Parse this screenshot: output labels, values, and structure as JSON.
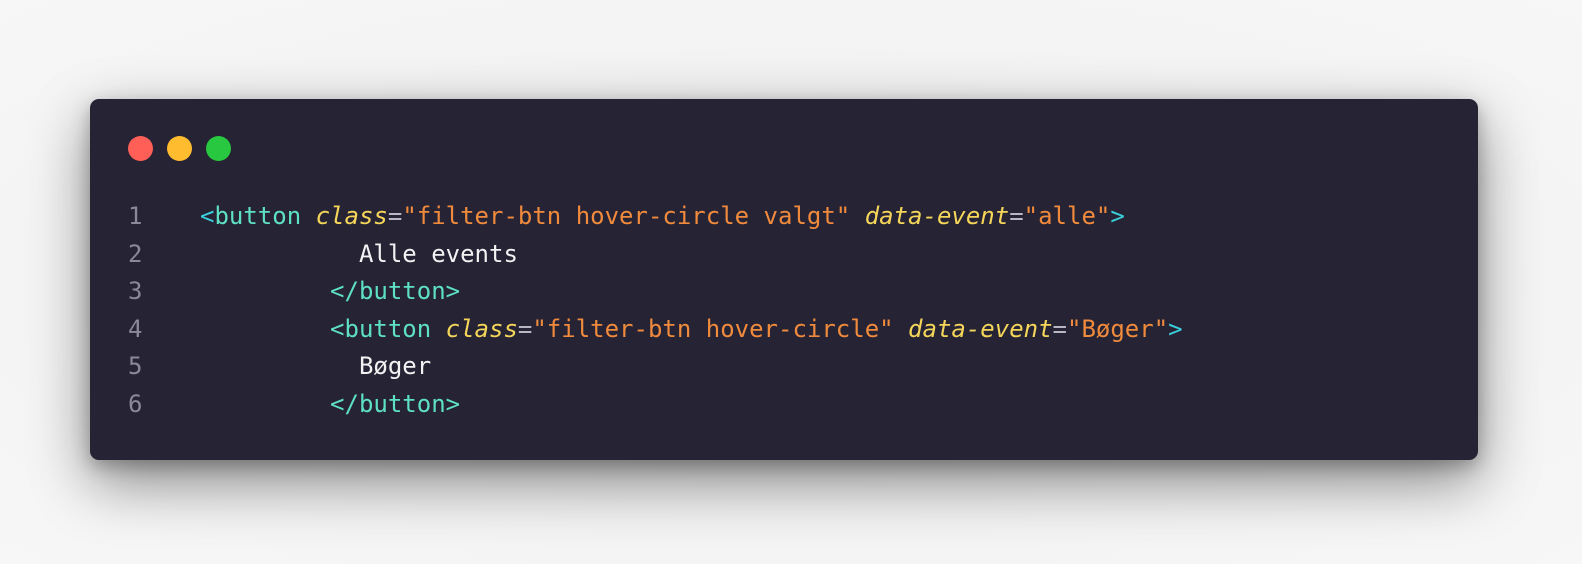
{
  "window": {
    "background": "#252334",
    "controls": [
      {
        "name": "close",
        "color": "#ff5f57"
      },
      {
        "name": "minimize",
        "color": "#febc2e"
      },
      {
        "name": "maximize",
        "color": "#28c840"
      }
    ]
  },
  "colors": {
    "tag": "#5ee0c5",
    "punctuation": "#3ad0dd",
    "attribute": "#f5d65a",
    "string": "#f08a3c",
    "text": "#f2f2f2",
    "line_number": "#8a8899"
  },
  "code": {
    "line_numbers": [
      "1",
      "2",
      "3",
      "4",
      "5",
      "6"
    ],
    "line1": {
      "open": "<",
      "tag": "button",
      "attr1": "class",
      "eq1": "=",
      "val1": "\"filter-btn hover-circle valgt\"",
      "attr2": "data-event",
      "eq2": "=",
      "val2": "\"alle\"",
      "close": ">"
    },
    "line2": {
      "indent": "           ",
      "text": "Alle events"
    },
    "line3": {
      "indent": "         ",
      "open": "</",
      "tag": "button",
      "close": ">"
    },
    "line4": {
      "indent": "         ",
      "open": "<",
      "tag": "button",
      "attr1": "class",
      "eq1": "=",
      "val1": "\"filter-btn hover-circle\"",
      "attr2": "data-event",
      "eq2": "=",
      "val2": "\"Bøger\"",
      "close": ">"
    },
    "line5": {
      "indent": "           ",
      "text": "Bøger"
    },
    "line6": {
      "indent": "         ",
      "open": "</",
      "tag": "button",
      "close": ">"
    }
  }
}
